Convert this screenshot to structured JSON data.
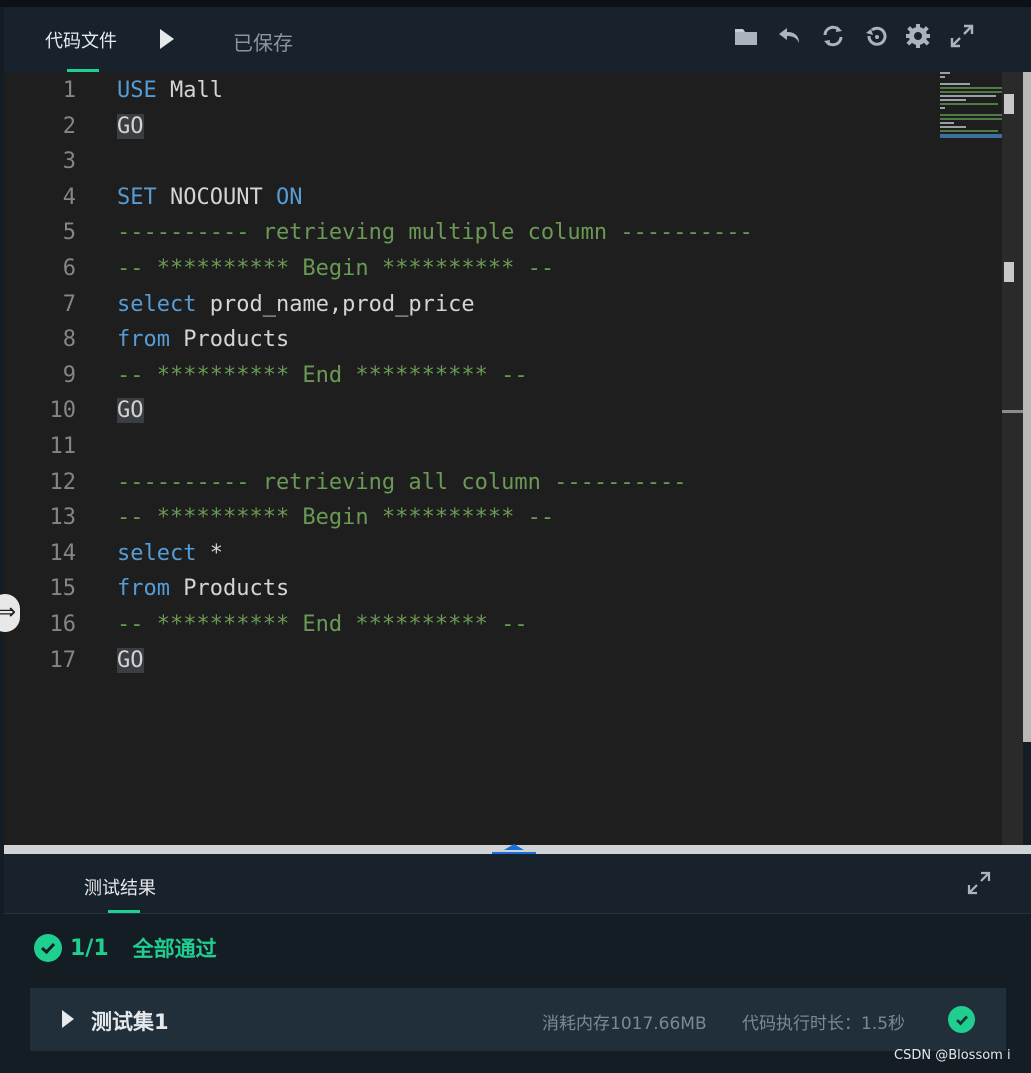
{
  "toolbar": {
    "tab_label": "代码文件",
    "saved_label": "已保存",
    "icons": [
      "folder-icon",
      "undo-icon",
      "refresh-icon",
      "history-icon",
      "gear-icon",
      "fullscreen-icon"
    ]
  },
  "editor": {
    "lines": [
      {
        "num": "1",
        "tokens": [
          {
            "t": "USE",
            "c": "kw"
          },
          {
            "t": " Mall",
            "c": ""
          }
        ]
      },
      {
        "num": "2",
        "tokens": [
          {
            "t": "GO",
            "c": "go"
          }
        ]
      },
      {
        "num": "3",
        "tokens": []
      },
      {
        "num": "4",
        "tokens": [
          {
            "t": "SET",
            "c": "kw"
          },
          {
            "t": " NOCOUNT ",
            "c": ""
          },
          {
            "t": "ON",
            "c": "kw"
          }
        ]
      },
      {
        "num": "5",
        "tokens": [
          {
            "t": "---------- retrieving multiple column ----------",
            "c": "cm"
          }
        ]
      },
      {
        "num": "6",
        "tokens": [
          {
            "t": "-- ********** Begin ********** --",
            "c": "cm"
          }
        ]
      },
      {
        "num": "7",
        "tokens": [
          {
            "t": "select",
            "c": "kw"
          },
          {
            "t": " prod_name,prod_price",
            "c": ""
          }
        ]
      },
      {
        "num": "8",
        "tokens": [
          {
            "t": "from",
            "c": "kw"
          },
          {
            "t": " Products",
            "c": ""
          }
        ]
      },
      {
        "num": "9",
        "tokens": [
          {
            "t": "-- ********** End ********** --",
            "c": "cm"
          }
        ]
      },
      {
        "num": "10",
        "tokens": [
          {
            "t": "GO",
            "c": "go"
          }
        ]
      },
      {
        "num": "11",
        "tokens": []
      },
      {
        "num": "12",
        "tokens": [
          {
            "t": "---------- retrieving all column ----------",
            "c": "cm"
          }
        ]
      },
      {
        "num": "13",
        "tokens": [
          {
            "t": "-- ********** Begin ********** --",
            "c": "cm"
          }
        ]
      },
      {
        "num": "14",
        "tokens": [
          {
            "t": "select",
            "c": "kw"
          },
          {
            "t": " *",
            "c": ""
          }
        ]
      },
      {
        "num": "15",
        "tokens": [
          {
            "t": "from",
            "c": "kw"
          },
          {
            "t": " Products",
            "c": ""
          }
        ]
      },
      {
        "num": "16",
        "tokens": [
          {
            "t": "-- ********** End ********** --",
            "c": "cm"
          }
        ]
      },
      {
        "num": "17",
        "tokens": [
          {
            "t": "GO",
            "c": "go"
          }
        ]
      }
    ]
  },
  "results": {
    "tab_label": "测试结果",
    "pass_count": "1/1",
    "pass_text": "全部通过",
    "testset": {
      "label": "测试集1",
      "memory": "消耗内存1017.66MB",
      "time": "代码执行时长：1.5秒"
    }
  },
  "watermark": "CSDN @Blossom i",
  "colors": {
    "accent": "#1fcf8f",
    "keyword": "#569cd6",
    "comment": "#6a9955",
    "editor_bg": "#1e1e1e"
  }
}
